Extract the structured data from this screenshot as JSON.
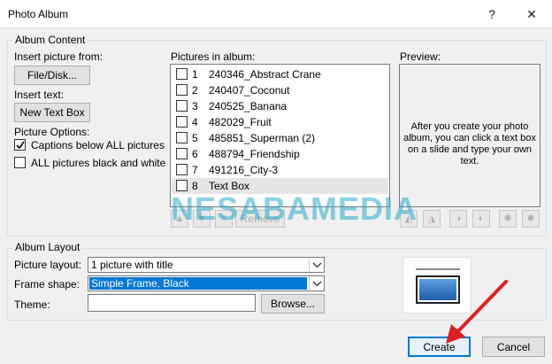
{
  "window": {
    "title": "Photo Album",
    "help": "?",
    "close": "✕"
  },
  "album_content": {
    "group_label": "Album Content",
    "insert_picture_label": "Insert picture from:",
    "file_disk_button": "File/Disk...",
    "insert_text_label": "Insert text:",
    "new_text_box_button": "New Text Box",
    "picture_options_label": "Picture Options:",
    "captions_option": "Captions below ALL pictures",
    "black_white_option": "ALL pictures black and white",
    "pictures_label": "Pictures in album:",
    "pictures": [
      {
        "num": "1",
        "name": "240346_Abstract Crane"
      },
      {
        "num": "2",
        "name": "240407_Coconut"
      },
      {
        "num": "3",
        "name": "240525_Banana"
      },
      {
        "num": "4",
        "name": "482029_Fruit"
      },
      {
        "num": "5",
        "name": "485851_Superman (2)"
      },
      {
        "num": "6",
        "name": "488794_Friendship"
      },
      {
        "num": "7",
        "name": "491216_City-3"
      },
      {
        "num": "8",
        "name": "Text Box"
      }
    ],
    "remove_button": "Remove",
    "preview_label": "Preview:",
    "preview_text": "After you create your photo album, you can click a text box on a slide and type your own text."
  },
  "album_layout": {
    "group_label": "Album Layout",
    "picture_layout_label": "Picture layout:",
    "picture_layout_value": "1 picture with title",
    "frame_shape_label": "Frame shape:",
    "frame_shape_value": "Simple Frame, Black",
    "theme_label": "Theme:",
    "theme_value": "",
    "browse_button": "Browse..."
  },
  "footer": {
    "create_button": "Create",
    "cancel_button": "Cancel"
  },
  "watermark": "NESABAMEDIA",
  "colors": {
    "accent": "#0078d7",
    "arrow": "#e02020"
  }
}
